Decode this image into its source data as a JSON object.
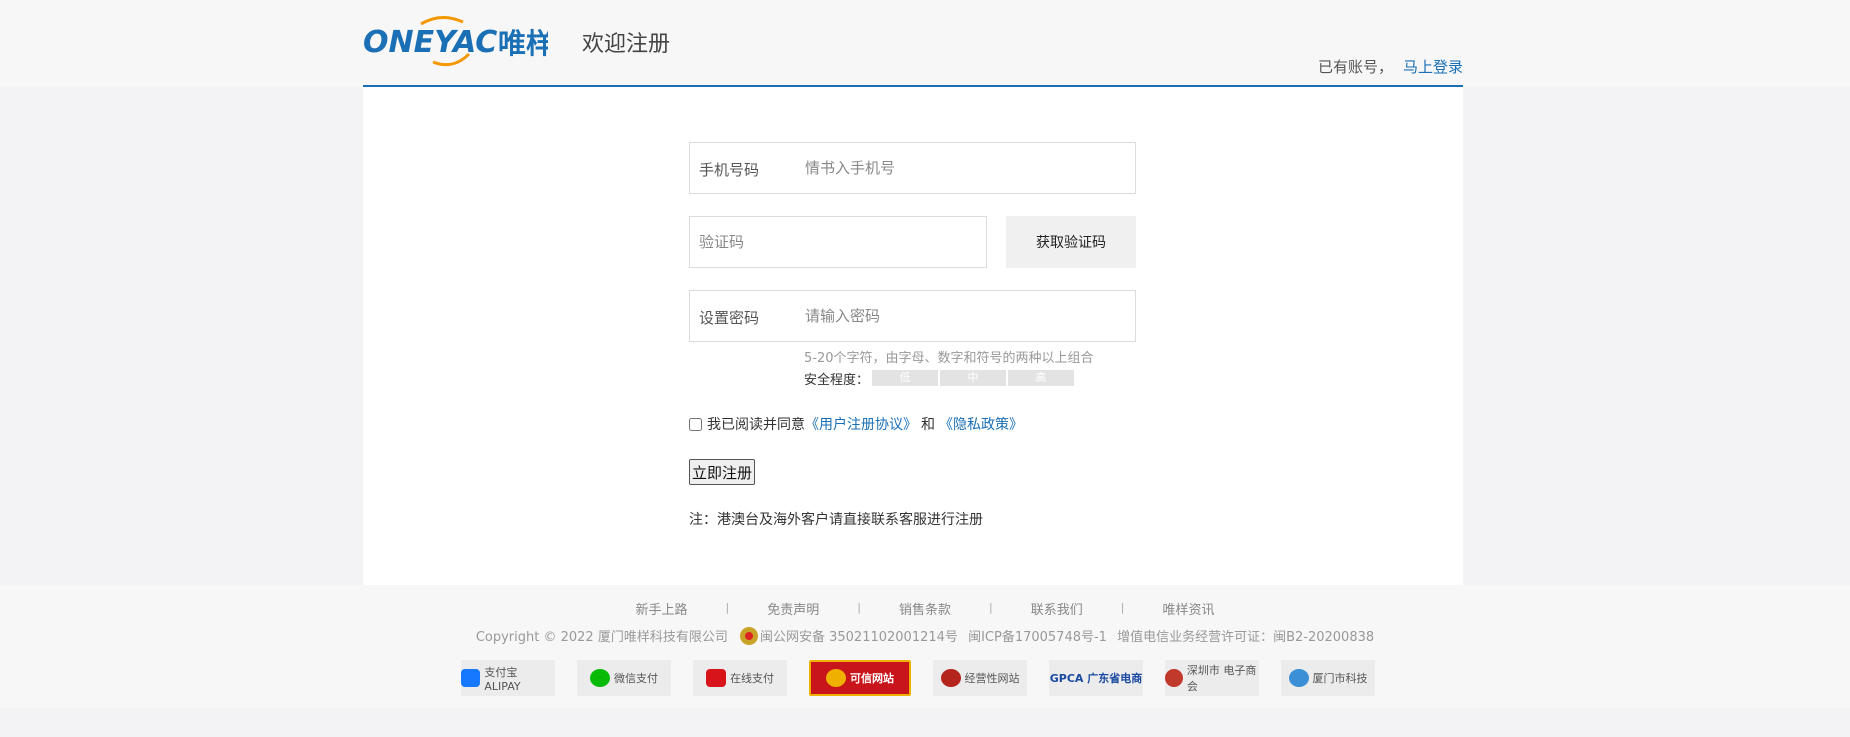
{
  "brand": {
    "logo_text": "ONEYAC",
    "logo_cn": "唯样",
    "accent": "#1a6fb5",
    "orange": "#f39800"
  },
  "header": {
    "title": "欢迎注册",
    "login_hint": "已有账号，",
    "login_link": "马上登录"
  },
  "form": {
    "phone": {
      "label": "手机号码",
      "placeholder": "情书入手机号"
    },
    "code": {
      "label": "验证码",
      "button": "获取验证码"
    },
    "password": {
      "label": "设置密码",
      "placeholder": "请输入密码",
      "tip": "5-20个字符，由字母、数字和符号的两种以上组合"
    },
    "strength": {
      "label": "安全程度：",
      "levels": [
        "低",
        "中",
        "高"
      ]
    },
    "agree": {
      "prefix": "我已阅读并同意",
      "terms": "《用户注册协议》",
      "and": "和",
      "privacy": "《隐私政策》",
      "checked": false
    },
    "submit": "立即注册",
    "note": "注：港澳台及海外客户请直接联系客服进行注册"
  },
  "footer": {
    "links": [
      "新手上路",
      "免责声明",
      "销售条款",
      "联系我们",
      "唯样资讯"
    ],
    "separator": "|",
    "copyright": "Copyright © 2022 厦门唯样科技有限公司",
    "police": "闽公网安备 35021102001214号",
    "icp": "闽ICP备17005748号-1",
    "license": "增值电信业务经营许可证：闽B2-20200838",
    "badges": [
      {
        "icon": "alipay-icon",
        "text": "支付宝 ALIPAY"
      },
      {
        "icon": "wechat-pay-icon",
        "text": "微信支付"
      },
      {
        "icon": "unionpay-icon",
        "text": "在线支付"
      },
      {
        "icon": "trusted-site-icon",
        "text": "可信网站"
      },
      {
        "icon": "business-site-icon",
        "text": "经营性网站"
      },
      {
        "icon": "gpca-icon",
        "text": "GPCA 广东省电商"
      },
      {
        "icon": "shenzhen-commerce-icon",
        "text": "深圳市 电子商会"
      },
      {
        "icon": "xiamen-tech-icon",
        "text": "厦门市科技"
      }
    ]
  }
}
